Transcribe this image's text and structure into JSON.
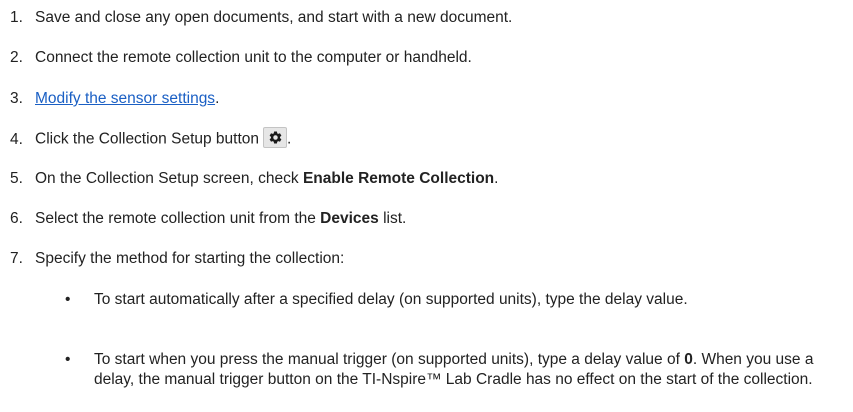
{
  "steps": [
    {
      "num": "1.",
      "text": "Save and close any open documents, and start with a new document."
    },
    {
      "num": "2.",
      "text": "Connect the remote collection unit to the computer or handheld."
    },
    {
      "num": "3.",
      "link": "Modify the sensor settings",
      "after": "."
    },
    {
      "num": "4.",
      "before": "Click the Collection Setup button",
      "after": ".",
      "icon": "gear-icon"
    },
    {
      "num": "5.",
      "before": "On the Collection Setup screen, check ",
      "bold": "Enable Remote Collection",
      "after": "."
    },
    {
      "num": "6.",
      "before": "Select the remote collection unit from the ",
      "bold": "Devices",
      "after": " list."
    },
    {
      "num": "7.",
      "text": "Specify the method for starting the collection:"
    }
  ],
  "bullets": [
    {
      "symbol": "•",
      "text": "To start automatically after a specified delay (on supported units), type the delay value."
    },
    {
      "symbol": "•",
      "before": "To start when you press the manual trigger (on supported units), type a delay value of ",
      "bold": "0",
      "after": ". When you use a delay, the manual trigger button on the TI-Nspire™ Lab Cradle has no effect on the start of the collection."
    }
  ]
}
